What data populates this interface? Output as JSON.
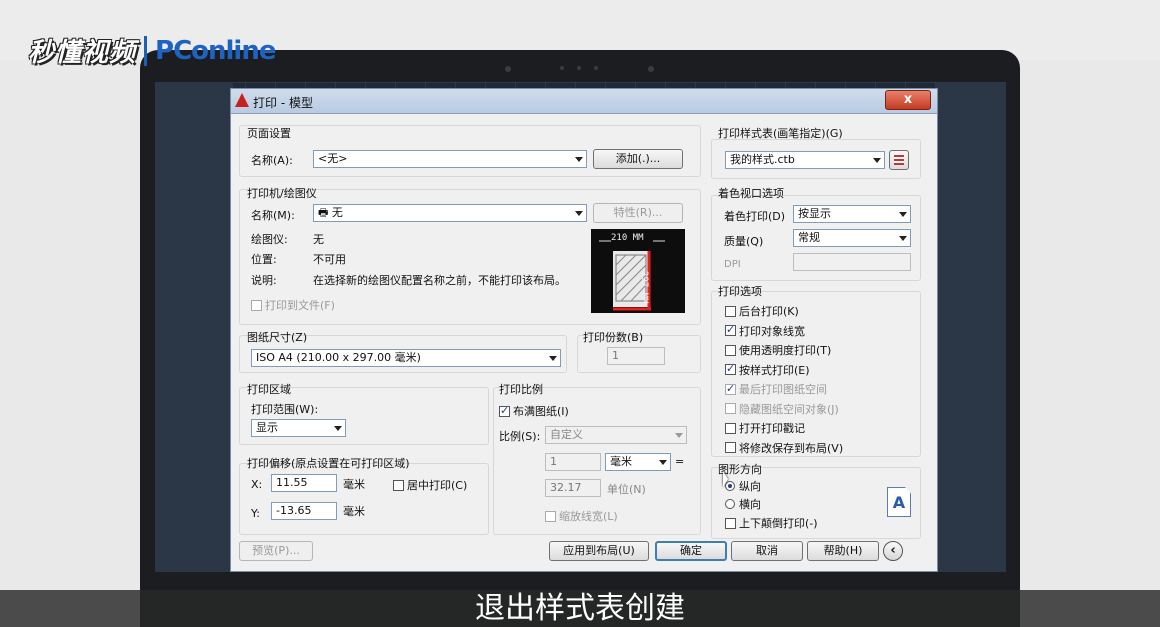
{
  "watermark": {
    "brand_cn": "秒懂视频",
    "brand_pc": "PConline"
  },
  "dialog": {
    "title": "打印 - 模型",
    "close_label": "x",
    "page_setup": {
      "group_label": "页面设置",
      "name_label": "名称(A):",
      "name_value": "<无>",
      "add_button": "添加(.)..."
    },
    "printer": {
      "group_label": "打印机/绘图仪",
      "name_label": "名称(M):",
      "name_value": "无",
      "properties_button": "特性(R)...",
      "plotter_label": "绘图仪:",
      "plotter_value": "无",
      "where_label": "位置:",
      "where_value": "不可用",
      "desc_label": "说明:",
      "desc_value": "在选择新的绘图仪配置名称之前，不能打印该布局。",
      "print_to_file": "打印到文件(F)",
      "preview_width": "210 MM",
      "preview_height": "297 MM"
    },
    "paper_size": {
      "group_label": "图纸尺寸(Z)",
      "value": "ISO A4 (210.00 x 297.00 毫米)"
    },
    "copies": {
      "group_label": "打印份数(B)",
      "value": "1"
    },
    "plot_area": {
      "group_label": "打印区域",
      "range_label": "打印范围(W):",
      "range_value": "显示"
    },
    "plot_offset": {
      "group_label": "打印偏移(原点设置在可打印区域)",
      "x_label": "X:",
      "x_value": "11.55",
      "x_unit": "毫米",
      "y_label": "Y:",
      "y_value": "-13.65",
      "y_unit": "毫米",
      "center_label": "居中打印(C)"
    },
    "plot_scale": {
      "group_label": "打印比例",
      "fit_label": "布满图纸(I)",
      "scale_label": "比例(S):",
      "scale_value": "自定义",
      "val1": "1",
      "unit1": "毫米",
      "equals": "=",
      "val2": "32.17",
      "unit2": "单位(N)",
      "lineweights_label": "缩放线宽(L)"
    },
    "style_table": {
      "group_label": "打印样式表(画笔指定)(G)",
      "value": "我的样式.ctb"
    },
    "shaded": {
      "group_label": "着色视口选项",
      "shade_label": "着色打印(D)",
      "shade_value": "按显示",
      "quality_label": "质量(Q)",
      "quality_value": "常规",
      "dpi_label": "DPI"
    },
    "plot_options": {
      "group_label": "打印选项",
      "items": [
        {
          "label": "后台打印(K)",
          "checked": false,
          "disabled": false
        },
        {
          "label": "打印对象线宽",
          "checked": true,
          "disabled": false
        },
        {
          "label": "使用透明度打印(T)",
          "checked": false,
          "disabled": false
        },
        {
          "label": "按样式打印(E)",
          "checked": true,
          "disabled": false
        },
        {
          "label": "最后打印图纸空间",
          "checked": true,
          "disabled": true
        },
        {
          "label": "隐藏图纸空间对象(J)",
          "checked": false,
          "disabled": true
        },
        {
          "label": "打开打印戳记",
          "checked": false,
          "disabled": false
        },
        {
          "label": "将修改保存到布局(V)",
          "checked": false,
          "disabled": false
        }
      ]
    },
    "orientation": {
      "group_label": "图形方向",
      "portrait": "纵向",
      "landscape": "横向",
      "upside_down": "上下颠倒打印(-)",
      "orientation_icon": "A"
    },
    "buttons": {
      "preview": "预览(P)...",
      "apply": "应用到布局(U)",
      "ok": "确定",
      "cancel": "取消",
      "help": "帮助(H)",
      "collapse": "‹"
    }
  },
  "subtitle": "退出样式表创建"
}
